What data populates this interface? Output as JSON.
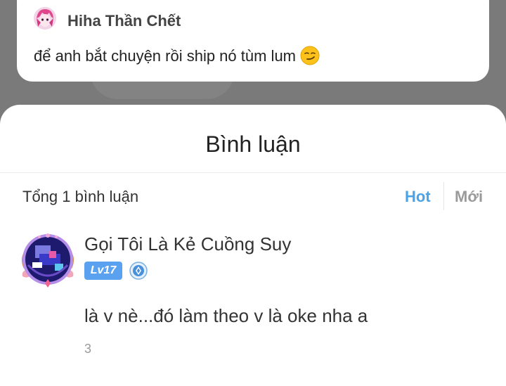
{
  "post": {
    "author": "Hiha Thần Chết",
    "text": "để anh bắt chuyện rồi ship nó tùm lum",
    "emoji": "smirking-face-icon"
  },
  "sheet": {
    "title": "Bình luận",
    "total": "Tổng 1 bình luận",
    "sort_hot": "Hot",
    "sort_new": "Mới"
  },
  "comments": [
    {
      "author": "Gọi Tôi Là Kẻ Cuồng Suy",
      "level": "Lv17",
      "text": "là v nè...đó làm theo v là oke nha a",
      "meta": "3"
    }
  ],
  "colors": {
    "accent": "#4aa3e6",
    "level_badge": "#5aa2f0",
    "muted": "#9a9a9a"
  }
}
